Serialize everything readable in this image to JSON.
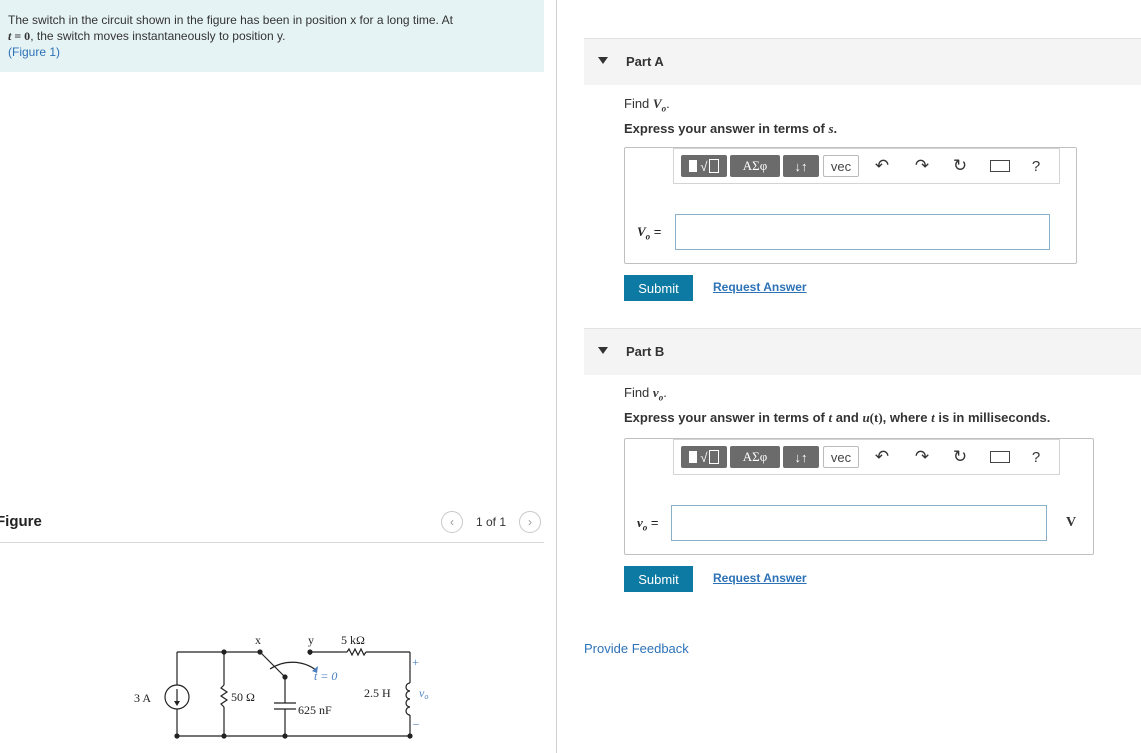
{
  "problem": {
    "line1": "The switch in the circuit shown in the figure has been in position x for a long time. At",
    "line2_var": "t",
    "line2_eq": " = 0",
    "line2_rest": ", the switch moves instantaneously to position y.",
    "figure_link": "(Figure 1)"
  },
  "figure": {
    "title": "Figure",
    "pager": "1 of 1",
    "prev_icon": "chevron-left-icon",
    "next_icon": "chevron-right-icon",
    "circuit": {
      "source": "3 A",
      "r1": "50 Ω",
      "cap": "625 nF",
      "sw_x": "x",
      "sw_y": "y",
      "sw_t": "t = 0",
      "r2": "5 kΩ",
      "ind": "2.5 H",
      "plus": "+",
      "minus": "–",
      "vo": "v",
      "vo_sub": "o"
    }
  },
  "toolbar": {
    "templates": "√",
    "greek": "ΑΣφ",
    "arrows": "↓↑",
    "vec": "vec",
    "undo_icon": "undo-icon",
    "redo_icon": "redo-icon",
    "reset_icon": "reset-icon",
    "keyboard_icon": "keyboard-icon",
    "help": "?"
  },
  "partA": {
    "label": "Part A",
    "find": "Find ",
    "find_var": "V",
    "find_sub": "o",
    "instr_pre": "Express your answer in terms of ",
    "instr_var": "s",
    "instr_post": ".",
    "answer_var": "V",
    "answer_sub": "o",
    "answer_eq": " =",
    "answer_value": "",
    "submit": "Submit",
    "request": "Request Answer"
  },
  "partB": {
    "label": "Part B",
    "find": "Find ",
    "find_var": "v",
    "find_sub": "o",
    "instr_pre": "Express your answer in terms of ",
    "instr_t1": "t",
    "instr_mid1": " and ",
    "instr_u": "u",
    "instr_paren": "(t)",
    "instr_mid2": ", where ",
    "instr_t2": "t",
    "instr_post": " is in milliseconds.",
    "answer_var": "v",
    "answer_sub": "o",
    "answer_eq": " =",
    "answer_value": "",
    "unit": "V",
    "submit": "Submit",
    "request": "Request Answer"
  },
  "feedback": "Provide Feedback"
}
